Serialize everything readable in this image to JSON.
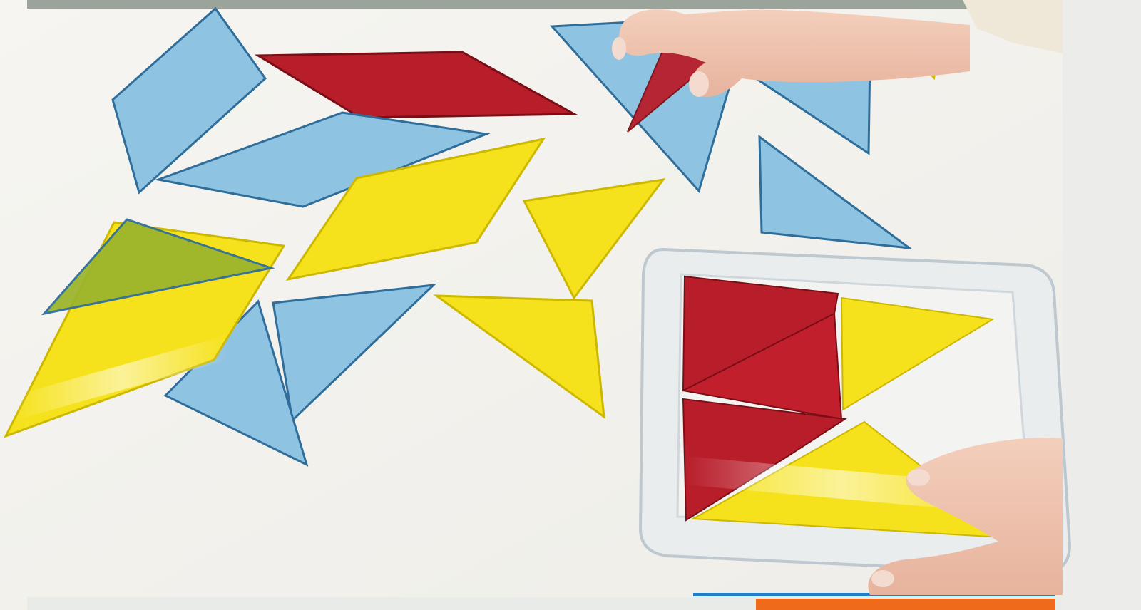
{
  "photo": {
    "subject": "tangram-pieces-on-table",
    "colors": {
      "table": "#f4f3ef",
      "blue_piece": "#8fc3e2",
      "blue_edge": "#2f6e9a",
      "red_piece": "#b81d2a",
      "yellow_piece": "#f6e21c",
      "green_overlap": "#9cb52c",
      "tray": "#e9edef",
      "skin": "#f1c9b4",
      "sleeve": "#efe8d8",
      "accent_line": "#1f7fcf",
      "accent_orange": "#ef6a1b"
    }
  }
}
